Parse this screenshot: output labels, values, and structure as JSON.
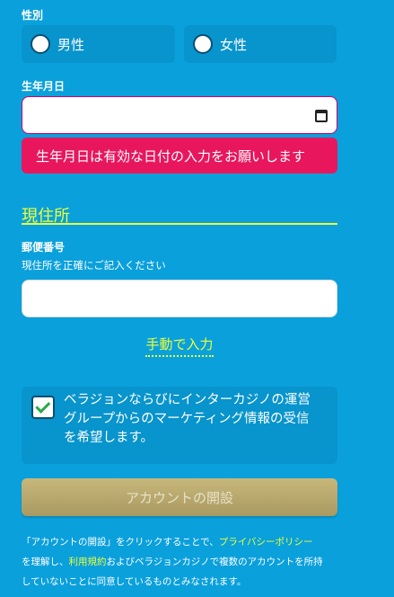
{
  "gender": {
    "label": "性別",
    "options": [
      "男性",
      "女性"
    ]
  },
  "birthdate": {
    "label": "生年月日",
    "value": "",
    "error": "生年月日は有効な日付の入力をお願いします"
  },
  "address": {
    "section_title": "現住所",
    "postal_label": "郵便番号",
    "postal_hint": "現住所を正確にご記入ください",
    "postal_value": "",
    "manual_link": "手動で入力"
  },
  "marketing": {
    "checked": true,
    "lines": [
      "ベラジョンならびにインターカジノの運営",
      "グループからのマーケティング情報の受信",
      "を希望します。"
    ]
  },
  "submit": {
    "label": "アカウントの開設"
  },
  "footer": {
    "line1_pre": "「アカウントの開設」をクリックすることで、",
    "privacy_link": "プライバシーポリシー",
    "line2_pre": "を理解し、",
    "terms_link": "利用規約",
    "line2_post": "およびベラジョンカジノで複数のアカウントを所持",
    "line3": "していないことに同意しているものとみなされます。"
  },
  "colors": {
    "background": "#0aa0dc",
    "accent_yellow": "#eaff3a",
    "error": "#e8175d",
    "button": "#bba96e"
  }
}
